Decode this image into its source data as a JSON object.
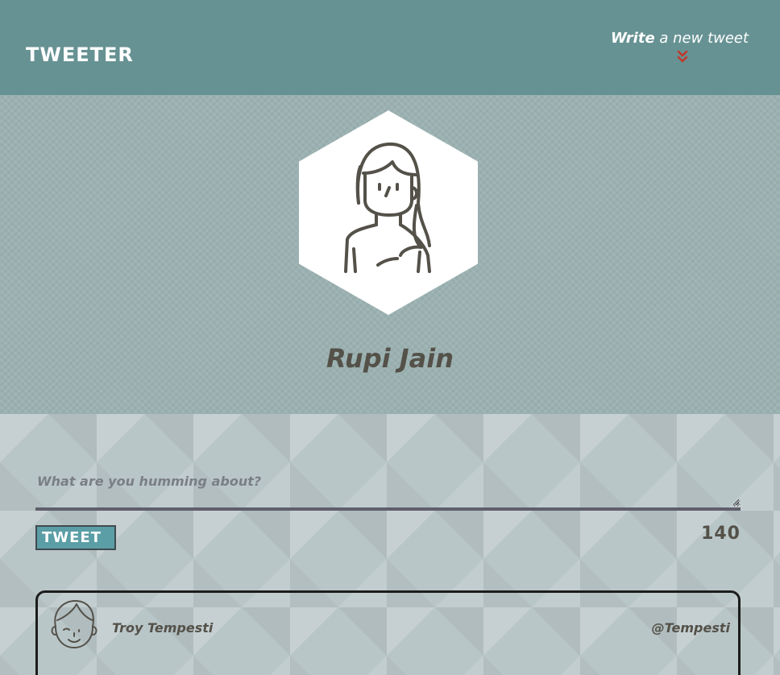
{
  "nav": {
    "brand": "TWEETER",
    "compose_strong": "Write",
    "compose_rest": " a new tweet",
    "chevron_color": "#c0392b"
  },
  "profile": {
    "name": "Rupi Jain",
    "avatar_icon": "woman-avatar-icon"
  },
  "composer": {
    "placeholder": "What are you humming about?",
    "value": "",
    "button_label": "TWEET",
    "char_count": "140"
  },
  "tweets": [
    {
      "avatar_icon": "man-avatar-icon",
      "author": "Troy Tempesti",
      "handle": "@Tempesti"
    }
  ],
  "colors": {
    "nav_bg": "#679293",
    "accent": "#5b9ea5",
    "text_dark": "#545149"
  }
}
